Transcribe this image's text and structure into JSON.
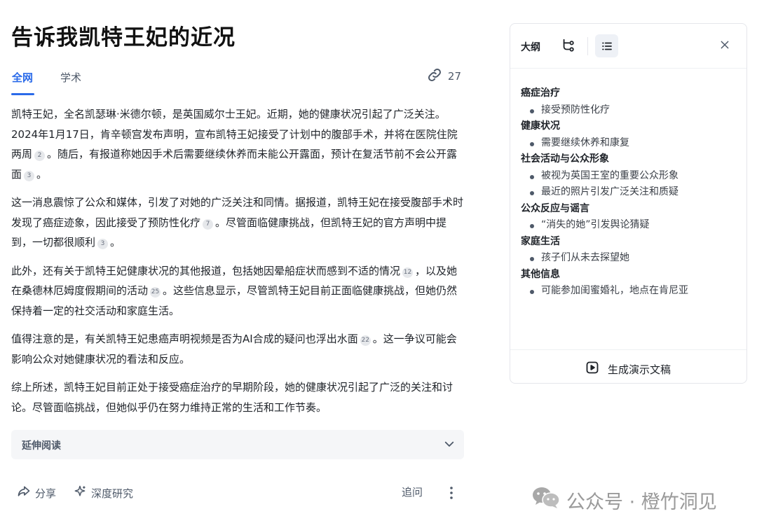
{
  "page": {
    "title": "告诉我凯特王妃的近况"
  },
  "tabs": [
    {
      "label": "全网"
    },
    {
      "label": "学术"
    }
  ],
  "sources": {
    "count": "27",
    "icon": "link-icon"
  },
  "article": {
    "p1": {
      "a": "凯特王妃，全名凯瑟琳·米德尔顿，是英国威尔士王妃。近期，她的健康状况引起了广泛关注。2024年1月17日，肯辛顿宫发布声明，宣布凯特王妃接受了计划中的腹部手术，并将在医院住院两周",
      "c1": "2",
      "b": "。随后，有报道称她因手术后需要继续休养而未能公开露面，预计在复活节前不会公开露面",
      "c2": "3",
      "c": "。"
    },
    "p2": {
      "a": "这一消息震惊了公众和媒体，引发了对她的广泛关注和同情。据报道，凯特王妃在接受腹部手术时发现了癌症迹象，因此接受了预防性化疗",
      "c1": "7",
      "b": "。尽管面临健康挑战，但凯特王妃的官方声明中提到，一切都很顺利",
      "c2": "3",
      "c": "。"
    },
    "p3": {
      "a": "此外，还有关于凯特王妃健康状况的其他报道，包括她因晕船症状而感到不适的情况",
      "c1": "12",
      "b": "，以及她在桑德林厄姆度假期间的活动",
      "c2": "25",
      "c": "。这些信息显示，尽管凯特王妃目前正面临健康挑战，但她仍然保持着一定的社交活动和家庭生活。"
    },
    "p4": {
      "a": "值得注意的是，有关凯特王妃患癌声明视频是否为AI合成的疑问也浮出水面",
      "c1": "22",
      "b": "。这一争议可能会影响公众对她健康状况的看法和反应。"
    },
    "p5": {
      "a": "综上所述，凯特王妃目前正处于接受癌症治疗的早期阶段，她的健康状况引起了广泛的关注和讨论。尽管面临挑战，但她似乎仍在努力维持正常的生活和工作节奏。"
    }
  },
  "extended_reading": {
    "label": "延伸阅读"
  },
  "actions": {
    "share": "分享",
    "deep_research": "深度研究",
    "follow_up": "追问"
  },
  "outline": {
    "title": "大纲",
    "sections": [
      {
        "heading": "癌症治疗",
        "items": [
          "接受预防性化疗"
        ]
      },
      {
        "heading": "健康状况",
        "items": [
          "需要继续休养和康复"
        ]
      },
      {
        "heading": "社会活动与公众形象",
        "items": [
          "被视为英国王室的重要公众形象",
          "最近的照片引发广泛关注和质疑"
        ]
      },
      {
        "heading": "公众反应与谣言",
        "items": [
          "“消失的她”引发舆论猜疑"
        ]
      },
      {
        "heading": "家庭生活",
        "items": [
          "孩子们从未去探望她"
        ]
      },
      {
        "heading": "其他信息",
        "items": [
          "可能参加闺蜜婚礼，地点在肯尼亚"
        ]
      }
    ],
    "generate_label": "生成演示文稿"
  },
  "watermark": {
    "text": "公众号 · 橙竹洞见"
  },
  "colors": {
    "accent": "#2a6ae9",
    "text": "#1f2329",
    "muted": "#4e5969"
  }
}
